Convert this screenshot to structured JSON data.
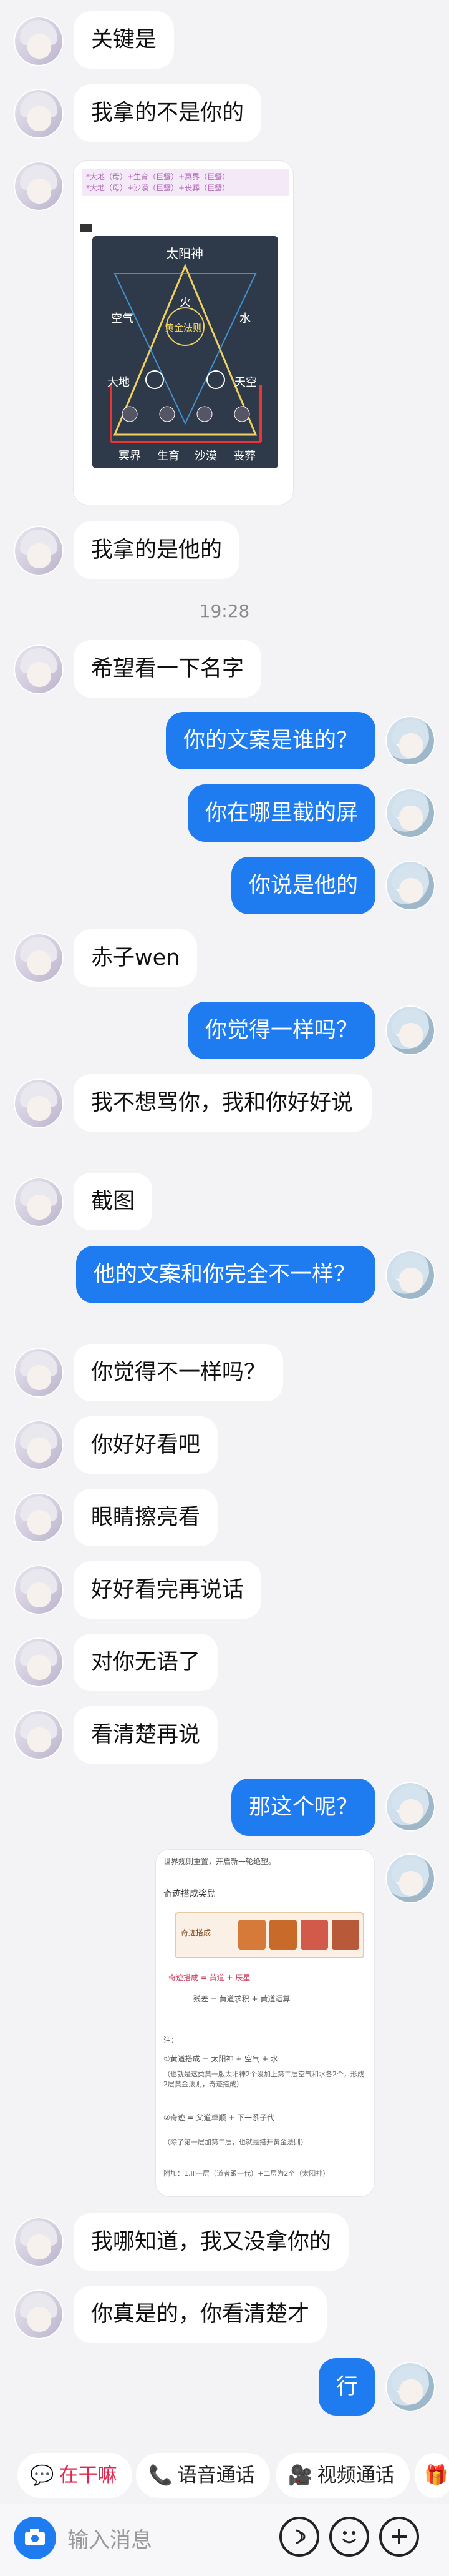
{
  "messages": [
    {
      "side": "left",
      "text": "关键是"
    },
    {
      "side": "left",
      "text": "我拿的不是你的"
    },
    {
      "side": "left",
      "text": "我拿的是他的"
    },
    {
      "side": "left",
      "text": "希望看一下名字"
    },
    {
      "side": "right",
      "text": "你的文案是谁的？"
    },
    {
      "side": "right",
      "text": "你在哪里截的屏"
    },
    {
      "side": "right",
      "text": "你说是他的"
    },
    {
      "side": "left",
      "text": "赤子wen"
    },
    {
      "side": "right",
      "text": "你觉得一样吗？"
    },
    {
      "side": "left",
      "text": "我不想骂你，我和你好好说"
    },
    {
      "side": "left",
      "text": "截图"
    },
    {
      "side": "right",
      "text": "他的文案和你完全不一样？"
    },
    {
      "side": "left",
      "text": "你觉得不一样吗？"
    },
    {
      "side": "left",
      "text": "你好好看吧"
    },
    {
      "side": "left",
      "text": "眼睛擦亮看"
    },
    {
      "side": "left",
      "text": "好好看完再说话"
    },
    {
      "side": "left",
      "text": "对你无语了"
    },
    {
      "side": "left",
      "text": "看清楚再说"
    },
    {
      "side": "right",
      "text": "那这个呢？"
    },
    {
      "side": "left",
      "text": "我哪知道，我又没拿你的"
    },
    {
      "side": "left",
      "text": "你真是的，你看清楚才"
    },
    {
      "side": "right",
      "text": "行"
    }
  ],
  "timestamp": "19:28",
  "image1": {
    "line1": "*大地（母）+生育（巨蟹）+冥界（巨蟹）",
    "line2": "*大地（母）+沙漠（巨蟹）+丧葬（巨蟹）",
    "diagram": {
      "sun": "太阳神",
      "fire": "火",
      "core": "黄金法则",
      "air": "空气",
      "water": "水",
      "earth": "大地",
      "sky": "天空",
      "row": [
        "冥界",
        "生育",
        "沙漠",
        "丧葬"
      ]
    }
  },
  "image2": {
    "top": "世界规则重置，开启新一轮绝望。",
    "title": "奇迹搭成奖励",
    "badge": "奇迹搭成",
    "line_a": "奇迹搭成 = 黄道 + 辰星",
    "line_b": "残差 = 黄道求积 + 黄道运算",
    "note_title": "注：",
    "note1": "①黄道搭成 = 太阳神 + 空气 + 水",
    "note1b": "（也就是这类黄一版太阳神2个没加上第二层空气和水各2个，形成2层黄金法则，奇迹搭成）",
    "note2": "②奇迹 = 父道卓顺 + 下一系子代",
    "note2b": "（除了第一层加第二层，也就是搭开黄金法则）",
    "note3": "附加：1.ⅠⅡ一层（道者跟一代）+二层为2个（太阳神）"
  },
  "toolbar": {
    "chips": [
      {
        "icon": "heart-icon",
        "label": "在干嘛",
        "color": "#e0244a"
      },
      {
        "icon": "phone-icon",
        "label": "语音通话",
        "color": "#1f7cf0"
      },
      {
        "icon": "video-icon",
        "label": "视频通话",
        "color": "#1f7cf0"
      }
    ]
  },
  "input": {
    "placeholder": "输入消息"
  }
}
